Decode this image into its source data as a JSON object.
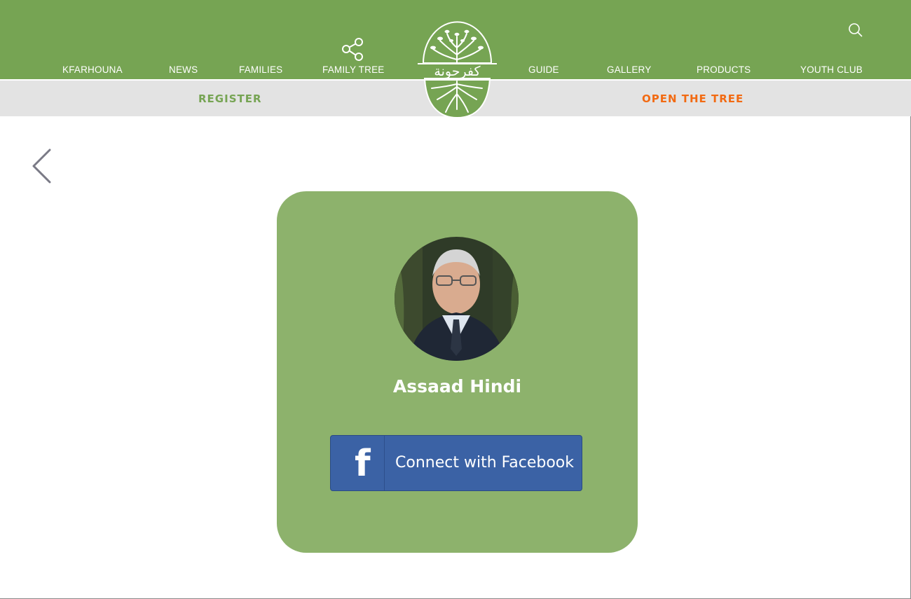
{
  "header": {
    "nav_items": [
      "KFARHOUNA",
      "NEWS",
      "FAMILIES",
      "FAMILY TREE",
      "GUIDE",
      "GALLERY",
      "PRODUCTS",
      "YOUTH CLUB"
    ],
    "logo_text": "كفرحونة",
    "search_icon": "search-icon",
    "family_tree_icon": "share-icon"
  },
  "subbar": {
    "register_label": "REGISTER",
    "open_tree_label": "OPEN THE TREE"
  },
  "profile": {
    "name": "Assaad Hindi",
    "facebook_button_label": "Connect with Facebook",
    "facebook_icon": "facebook-f-icon"
  },
  "colors": {
    "brand_green": "#76a453",
    "card_green": "#8db26c",
    "accent_orange": "#f26a12",
    "facebook_blue": "#3b62a5",
    "subbar_gray": "#e3e3e3"
  }
}
